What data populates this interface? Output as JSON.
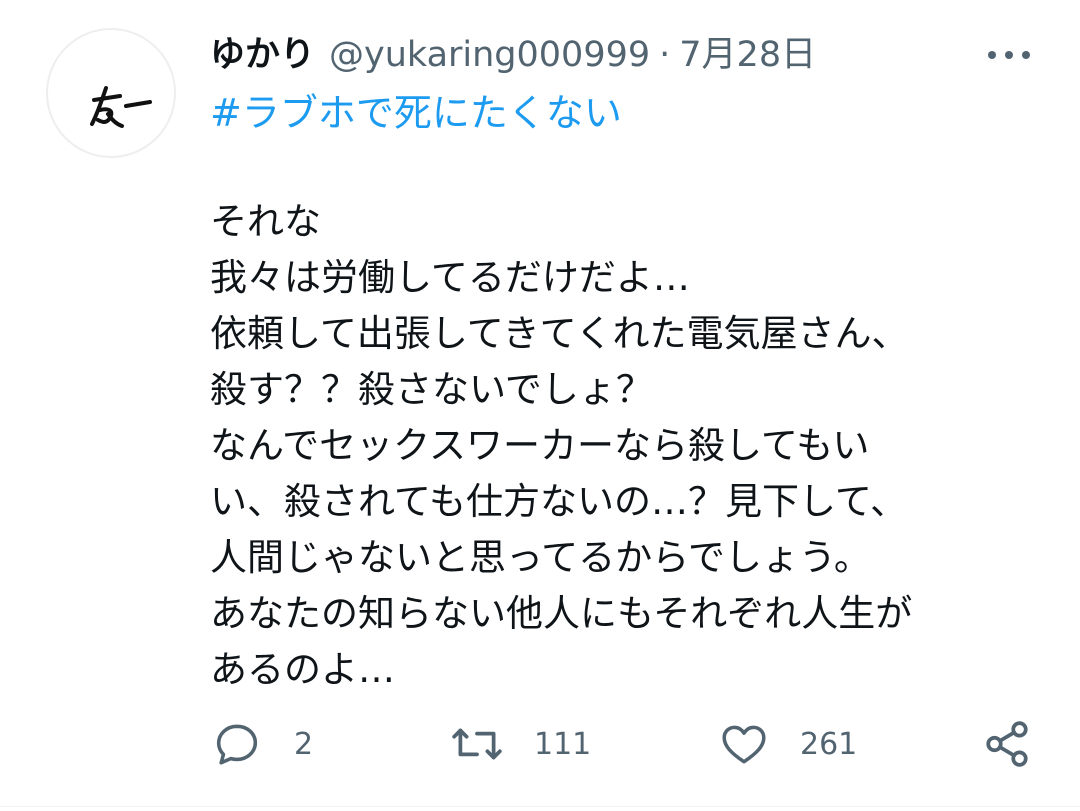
{
  "tweet": {
    "display_name": "ゆかり",
    "handle": "@yukaring000999",
    "separator": "·",
    "date": "7月28日",
    "hashtag": "#ラブホで死にたくない",
    "body_lines": [
      "それな",
      "我々は労働してるだけだよ…",
      "依頼して出張してきてくれた電気屋さん、",
      "殺す？？殺さないでしょ？",
      "なんでセックスワーカーなら殺してもい",
      "い、殺されても仕方ないの…？見下して、",
      "人間じゃないと思ってるからでしょう。",
      "あなたの知らない他人にもそれぞれ人生が",
      "あるのよ…"
    ],
    "avatar_text": "友ー"
  },
  "actions": {
    "reply_count": "2",
    "retweet_count": "111",
    "like_count": "261"
  },
  "icons": {
    "more": "more-horizontal-icon",
    "reply": "reply-icon",
    "retweet": "retweet-icon",
    "like": "heart-icon",
    "share": "share-icon"
  },
  "colors": {
    "text": "#0f1419",
    "secondary": "#536471",
    "link": "#1d9bf0"
  }
}
